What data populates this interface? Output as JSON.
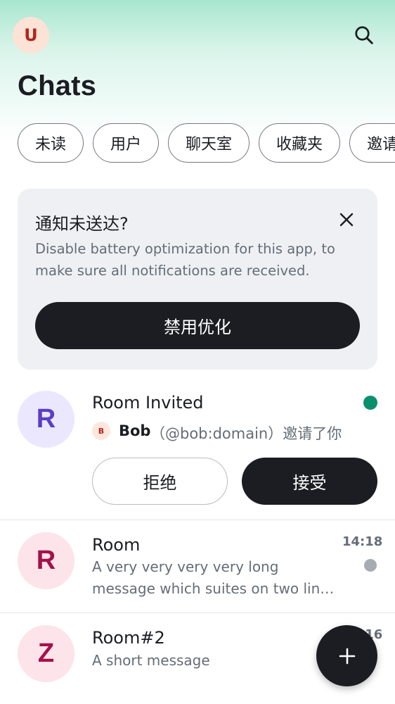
{
  "header": {
    "user_avatar_letter": "U",
    "title": "Chats"
  },
  "filters": [
    {
      "label": "未读"
    },
    {
      "label": "用户"
    },
    {
      "label": "聊天室"
    },
    {
      "label": "收藏夹"
    },
    {
      "label": "邀请"
    }
  ],
  "notice": {
    "title": "通知未送达?",
    "body": "Disable battery optimization for this app, to make sure all notifications are received.",
    "button_label": "禁用优化"
  },
  "invite": {
    "room_name": "Room Invited",
    "avatar_letter": "R",
    "inviter_avatar_letter": "B",
    "inviter_name": "Bob",
    "inviter_detail": "（@bob:domain）邀请了你",
    "decline_label": "拒绝",
    "accept_label": "接受",
    "dot_color": "#0a8f6c"
  },
  "rooms": [
    {
      "name": "Room",
      "avatar_letter": "R",
      "time": "14:18",
      "message": "A very very very very long message which suites on two lin…"
    },
    {
      "name": "Room#2",
      "avatar_letter": "Z",
      "time": "14:16",
      "message": "A short message"
    }
  ],
  "colors": {
    "accent_dark": "#1b1d22",
    "unread_green": "#0a8f6c",
    "muted_dot": "#a7abb3"
  },
  "icons": {
    "search": "search-icon",
    "close": "close-icon",
    "fab": "plus-icon"
  }
}
